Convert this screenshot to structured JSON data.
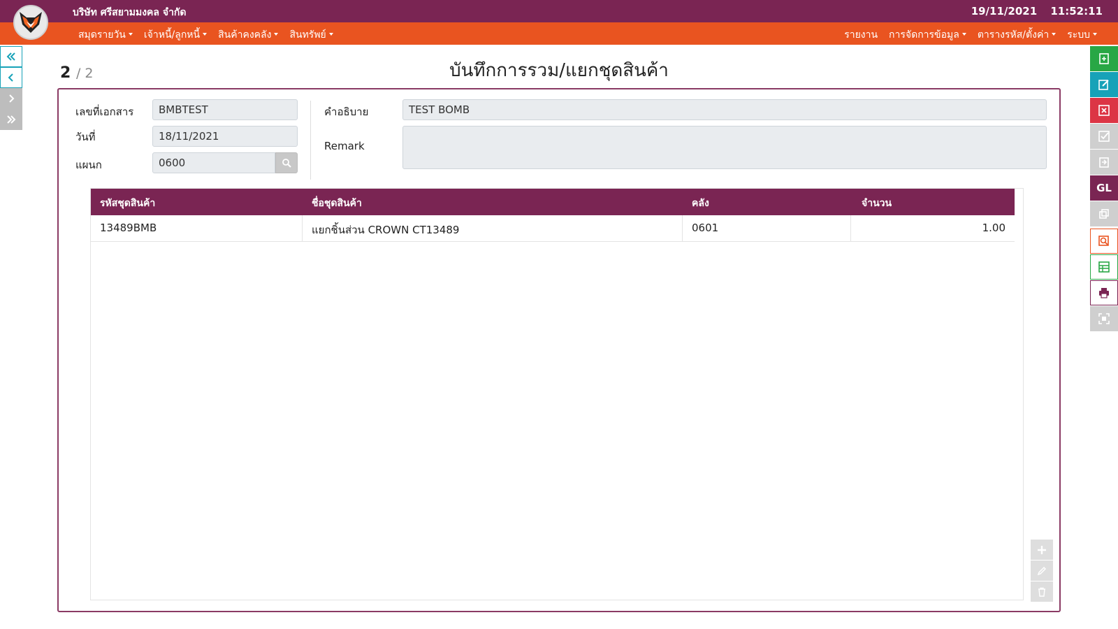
{
  "header": {
    "company": "บริษัท ศรีสยามมงคล จำกัด",
    "date": "19/11/2021",
    "time": "11:52:11"
  },
  "menu": {
    "left": [
      "สมุดรายวัน",
      "เจ้าหนี้/ลูกหนี้",
      "สินค้าคงคลัง",
      "สินทรัพย์"
    ],
    "right": [
      "รายงาน",
      "การจัดการข้อมูล",
      "ตารางรหัส/ตั้งค่า",
      "ระบบ"
    ]
  },
  "pager": {
    "current": "2",
    "total": "/ 2"
  },
  "page_title": "บันทึกการรวม/แยกชุดสินค้า",
  "form": {
    "doc_no_label": "เลขที่เอกสาร",
    "doc_no_value": "BMBTEST",
    "date_label": "วันที่",
    "date_value": "18/11/2021",
    "dept_label": "แผนก",
    "dept_value": "0600",
    "desc_label": "คำอธิบาย",
    "desc_value": "TEST BOMB",
    "remark_label": "Remark",
    "remark_value": ""
  },
  "grid": {
    "columns": [
      "รหัสชุดสินค้า",
      "ชื่อชุดสินค้า",
      "คลัง",
      "จำนวน"
    ],
    "rows": [
      [
        "13489BMB",
        "แยกชิ้นส่วน CROWN CT13489",
        "0601",
        "1.00"
      ]
    ]
  },
  "colors": {
    "brand_purple": "#7a2553",
    "menu_orange": "#e95420",
    "add_green": "#28a745",
    "edit_teal": "#17a2b8",
    "delete_red": "#dc3545"
  },
  "right_toolbar_icons": [
    "add-document-icon",
    "edit-document-icon",
    "cancel-document-icon",
    "approve-icon",
    "export-icon",
    "gl-icon",
    "copy-icon",
    "search-document-icon",
    "spreadsheet-icon",
    "print-icon",
    "scan-icon"
  ],
  "gl_label": "GL"
}
